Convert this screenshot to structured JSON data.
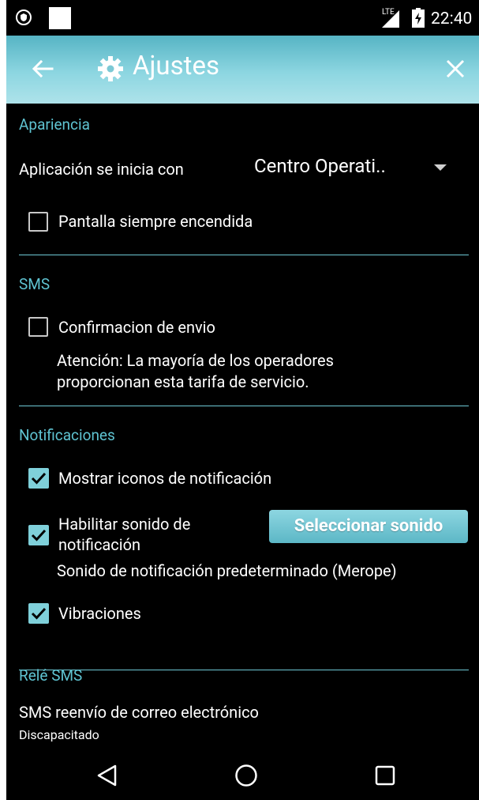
{
  "status_bar": {
    "time": "22:40",
    "network": "LTE"
  },
  "header": {
    "title": "Ajustes"
  },
  "sections": {
    "apariencia": {
      "title": "Apariencia",
      "startup_label": "Aplicación se inicia con",
      "startup_value": "Centro Operati..",
      "screen_on_label": "Pantalla siempre encendida",
      "screen_on_checked": false
    },
    "sms": {
      "title": "SMS",
      "confirm_label": "Confirmacion de envio",
      "confirm_checked": false,
      "note_line1": "Atención: La mayoría de los operadores",
      "note_line2": "proporcionan esta tarifa de servicio."
    },
    "notificaciones": {
      "title": "Notificaciones",
      "show_icons_label": "Mostrar iconos de notificación",
      "show_icons_checked": true,
      "sound_label_line1": "Habilitar sonido de",
      "sound_label_line2": "notificación",
      "sound_checked": true,
      "select_sound_button": "Seleccionar sonido",
      "default_sound": "Sonido de notificación predeterminado (Merope)",
      "vibration_label": "Vibraciones",
      "vibration_checked": true
    },
    "rele_sms": {
      "title": "Relé SMS",
      "forward_label": "SMS reenvío de correo electrónico",
      "forward_status": "Discapacitado"
    }
  },
  "colors": {
    "accent": "#5fc3d1",
    "header_bg": "#8dd6e1",
    "background": "#000000"
  },
  "icons": [
    "shield-icon",
    "signal-icon",
    "battery-icon",
    "back-arrow-icon",
    "gear-icon",
    "close-icon",
    "checkmark-icon",
    "dropdown-arrow-icon",
    "nav-back-icon",
    "nav-home-icon",
    "nav-recents-icon"
  ]
}
